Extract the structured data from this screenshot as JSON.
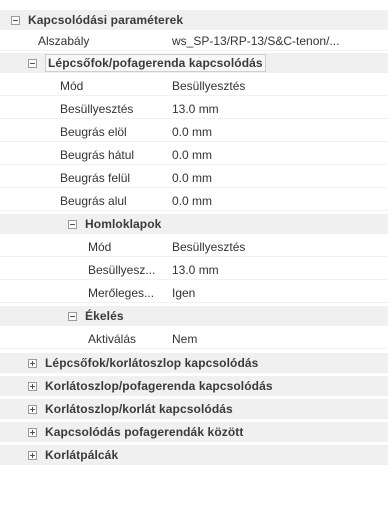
{
  "tree": {
    "root": {
      "title": "Kapcsolódási paraméterek",
      "toggle_icon": "minus-square-icon",
      "rule_label": "Alszabály",
      "rule_value": "ws_SP-13/RP-13/S&C-tenon/..."
    },
    "stringer_handrail": {
      "title": "Lépcsőfok/pofagerenda kapcsolódás",
      "toggle_icon": "minus-square-icon",
      "props": [
        {
          "label": "Mód",
          "value": "Besüllyesztés"
        },
        {
          "label": "Besüllyesztés",
          "value": "13.0 mm"
        },
        {
          "label": "Beugrás elöl",
          "value": "0.0 mm"
        },
        {
          "label": "Beugrás hátul",
          "value": "0.0 mm"
        },
        {
          "label": "Beugrás felül",
          "value": "0.0 mm"
        },
        {
          "label": "Beugrás alul",
          "value": "0.0 mm"
        }
      ]
    },
    "front_faces": {
      "title": "Homloklapok",
      "toggle_icon": "minus-square-icon",
      "props": [
        {
          "label": "Mód",
          "value": "Besüllyesztés"
        },
        {
          "label": "Besüllyesz...",
          "value": "13.0 mm"
        },
        {
          "label": "Merőleges...",
          "value": "Igen"
        }
      ]
    },
    "wedging": {
      "title": "Ékelés",
      "toggle_icon": "minus-square-icon",
      "props": [
        {
          "label": "Aktiválás",
          "value": "Nem"
        }
      ]
    },
    "collapsed_sections": [
      {
        "title": "Lépcsőfok/korlátoszlop kapcsolódás",
        "toggle_icon": "plus-square-icon"
      },
      {
        "title": "Korlátoszlop/pofagerenda kapcsolódás",
        "toggle_icon": "plus-square-icon"
      },
      {
        "title": "Korlátoszlop/korlát kapcsolódás",
        "toggle_icon": "plus-square-icon"
      },
      {
        "title": "Kapcsolódás pofagerendák között",
        "toggle_icon": "plus-square-icon"
      },
      {
        "title": "Korlátpálcák",
        "toggle_icon": "plus-square-icon"
      }
    ]
  }
}
